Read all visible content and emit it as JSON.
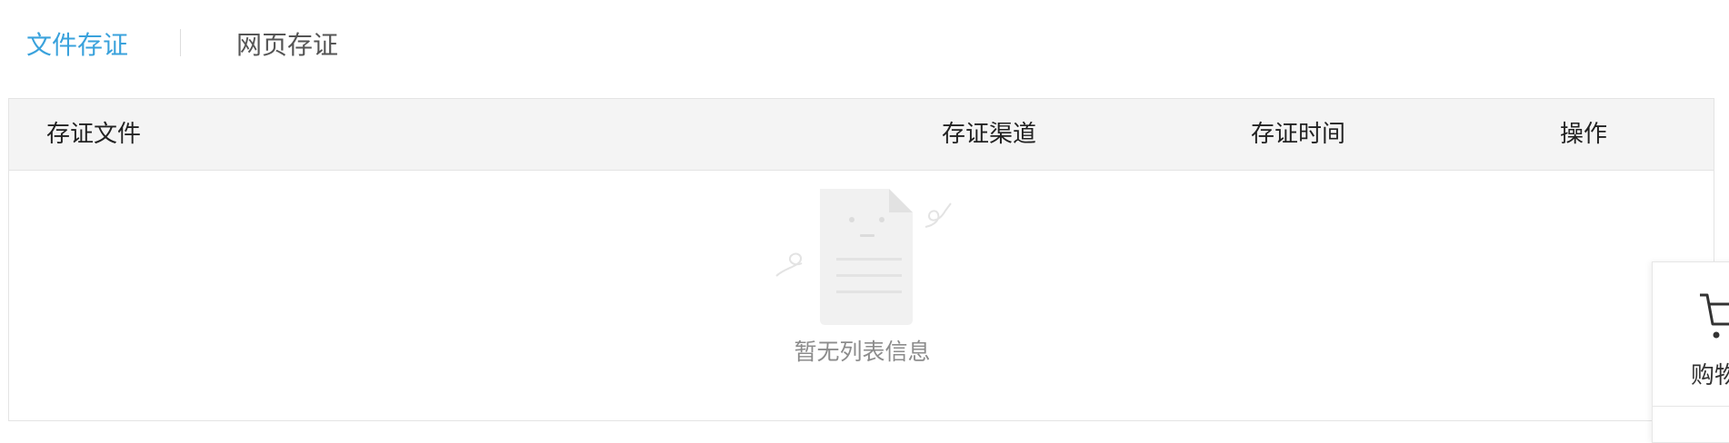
{
  "tabs": {
    "file": "文件存证",
    "web": "网页存证"
  },
  "table": {
    "headers": {
      "file": "存证文件",
      "channel": "存证渠道",
      "time": "存证时间",
      "operation": "操作"
    },
    "empty_text": "暂无列表信息",
    "empty_icon": "empty-document-icon"
  },
  "float_panel": {
    "cart_label": "购物",
    "cart_icon": "shopping-cart-icon"
  },
  "colors": {
    "accent": "#3aa2dc",
    "header_bg": "#f4f4f4",
    "border": "#e4e4e4",
    "muted_text": "#8c8c8c"
  }
}
